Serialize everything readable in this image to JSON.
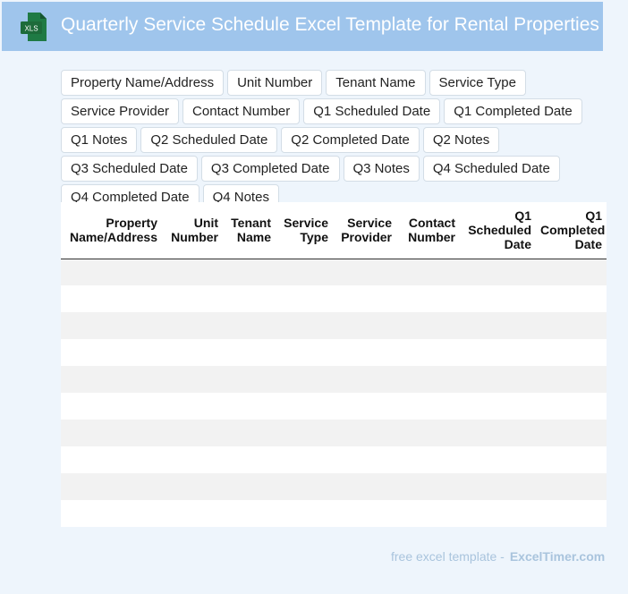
{
  "header": {
    "title": "Quarterly Service Schedule Excel Template for Rental Properties",
    "icon": {
      "name": "xls-file-icon",
      "label": "XLS",
      "color": "#1d6b3a"
    },
    "background": "#9fc5ec"
  },
  "fields": [
    "Property Name/Address",
    "Unit Number",
    "Tenant Name",
    "Service Type",
    "Service Provider",
    "Contact Number",
    "Q1 Scheduled Date",
    "Q1 Completed Date",
    "Q1 Notes",
    "Q2 Scheduled Date",
    "Q2 Completed Date",
    "Q2 Notes",
    "Q3 Scheduled Date",
    "Q3 Completed Date",
    "Q3 Notes",
    "Q4 Scheduled Date",
    "Q4 Completed Date",
    "Q4 Notes"
  ],
  "table": {
    "columns": [
      [
        "Property",
        "Name/Address"
      ],
      [
        "Unit",
        "Number"
      ],
      [
        "Tenant",
        "Name"
      ],
      [
        "Service",
        "Type"
      ],
      [
        "Service",
        "Provider"
      ],
      [
        "Contact",
        "Number"
      ],
      [
        "Q1",
        "Scheduled",
        "Date"
      ],
      [
        "Q1",
        "Completed",
        "Date"
      ]
    ],
    "rows": [
      [
        "",
        "",
        "",
        "",
        "",
        "",
        "",
        ""
      ],
      [
        "",
        "",
        "",
        "",
        "",
        "",
        "",
        ""
      ],
      [
        "",
        "",
        "",
        "",
        "",
        "",
        "",
        ""
      ],
      [
        "",
        "",
        "",
        "",
        "",
        "",
        "",
        ""
      ],
      [
        "",
        "",
        "",
        "",
        "",
        "",
        "",
        ""
      ],
      [
        "",
        "",
        "",
        "",
        "",
        "",
        "",
        ""
      ],
      [
        "",
        "",
        "",
        "",
        "",
        "",
        "",
        ""
      ],
      [
        "",
        "",
        "",
        "",
        "",
        "",
        "",
        ""
      ],
      [
        "",
        "",
        "",
        "",
        "",
        "",
        "",
        ""
      ],
      [
        "",
        "",
        "",
        "",
        "",
        "",
        "",
        ""
      ]
    ]
  },
  "footer": {
    "text": "free excel template -",
    "brand": "ExcelTimer.com"
  }
}
